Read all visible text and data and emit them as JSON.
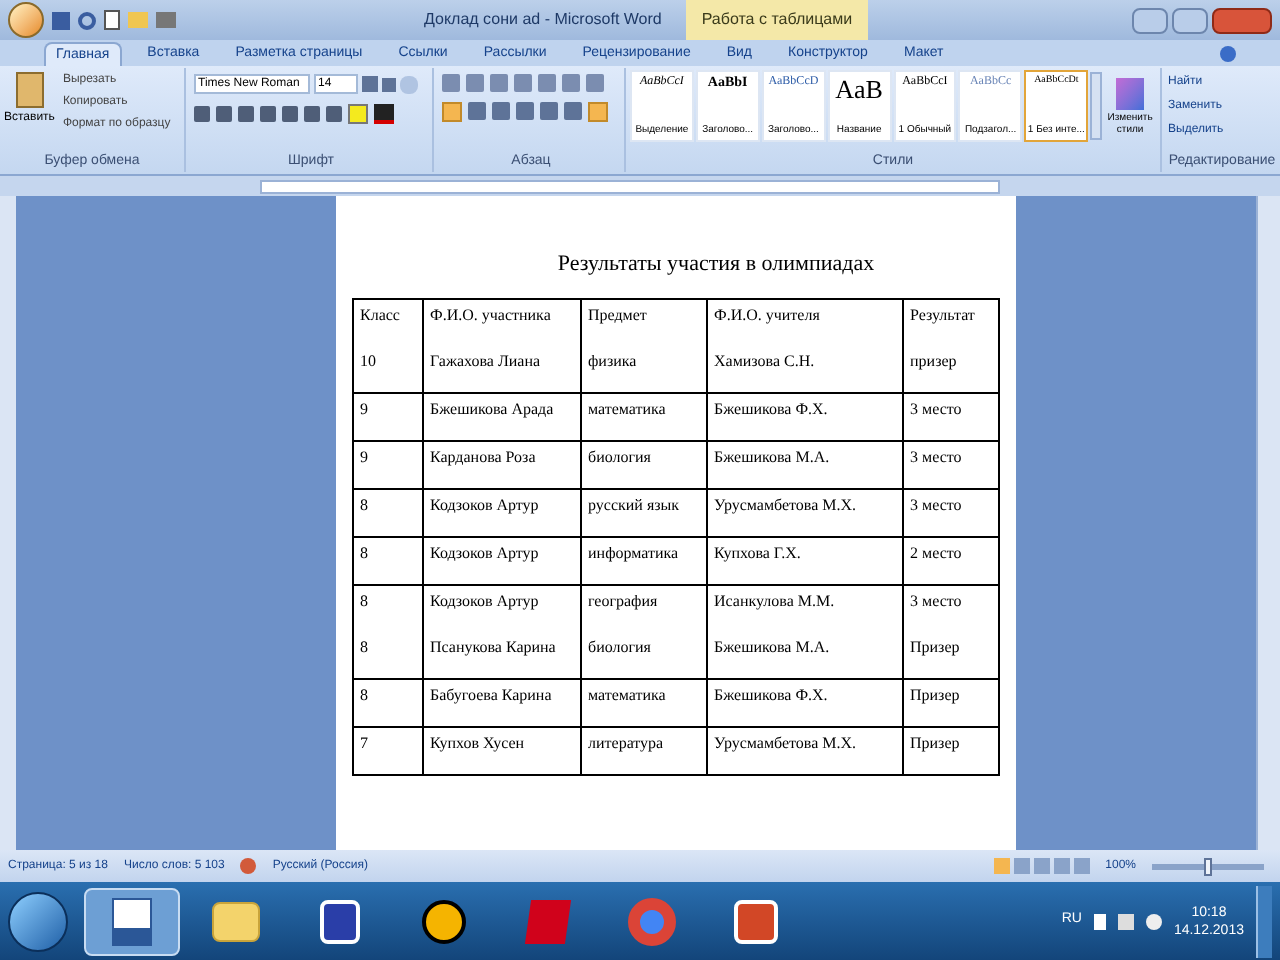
{
  "window": {
    "title": "Доклад сони ad - Microsoft Word",
    "context_tab": "Работа с таблицами"
  },
  "tabs": [
    {
      "label": "Главная",
      "selected": true
    },
    {
      "label": "Вставка",
      "selected": false
    },
    {
      "label": "Разметка страницы",
      "selected": false
    },
    {
      "label": "Ссылки",
      "selected": false
    },
    {
      "label": "Рассылки",
      "selected": false
    },
    {
      "label": "Рецензирование",
      "selected": false
    },
    {
      "label": "Вид",
      "selected": false
    },
    {
      "label": "Конструктор",
      "selected": false
    },
    {
      "label": "Макет",
      "selected": false
    }
  ],
  "ribbon": {
    "clipboard": {
      "label": "Буфер обмена",
      "paste": "Вставить",
      "items": [
        "Вырезать",
        "Копировать",
        "Формат по образцу"
      ]
    },
    "font": {
      "label": "Шрифт",
      "font_name": "Times New Roman",
      "font_size": "14"
    },
    "paragraph": {
      "label": "Абзац"
    },
    "styles": {
      "label": "Стили",
      "change": "Изменить стили",
      "items": [
        {
          "preview": "AaBbCcI",
          "name": "Выделение",
          "selected": false
        },
        {
          "preview": "AaBbI",
          "name": "Заголово...",
          "selected": false
        },
        {
          "preview": "AaBbCcD",
          "name": "Заголово...",
          "selected": false
        },
        {
          "preview": "AaB",
          "name": "Название",
          "selected": false
        },
        {
          "preview": "AaBbCcI",
          "name": "1 Обычный",
          "selected": false
        },
        {
          "preview": "AaBbCc",
          "name": "Подзагол...",
          "selected": false
        },
        {
          "preview": "AaBbCcDt",
          "name": "1 Без инте...",
          "selected": true
        }
      ]
    },
    "editing": {
      "label": "Редактирование",
      "items": [
        "Найти",
        "Заменить",
        "Выделить"
      ]
    }
  },
  "document": {
    "title": "Результаты участия в олимпиадах",
    "rows": [
      {
        "cells": [
          [
            "Класс",
            "10"
          ],
          [
            "Ф.И.О. участника",
            "Гажахова Лиана"
          ],
          [
            "Предмет",
            "физика"
          ],
          [
            "Ф.И.О. учителя",
            "Хамизова С.Н."
          ],
          [
            "Результат",
            "призер"
          ]
        ]
      },
      {
        "cells": [
          [
            "9"
          ],
          [
            "Бжешикова Арада"
          ],
          [
            "математика"
          ],
          [
            "Бжешикова Ф.Х."
          ],
          [
            "3  место"
          ]
        ]
      },
      {
        "cells": [
          [
            "9"
          ],
          [
            "Карданова Роза"
          ],
          [
            "биология"
          ],
          [
            "Бжешикова М.А."
          ],
          [
            "3  место"
          ]
        ]
      },
      {
        "cells": [
          [
            "8"
          ],
          [
            "Кодзоков Артур"
          ],
          [
            "русский язык"
          ],
          [
            "Урусмамбетова М.Х."
          ],
          [
            "3  место"
          ]
        ]
      },
      {
        "cells": [
          [
            "8"
          ],
          [
            "Кодзоков Артур"
          ],
          [
            "информатика"
          ],
          [
            "Купхова Г.Х."
          ],
          [
            "2 место"
          ]
        ]
      },
      {
        "cells": [
          [
            "8",
            "8"
          ],
          [
            "Кодзоков Артур",
            "Псанукова Карина"
          ],
          [
            "география",
            "биология"
          ],
          [
            "Исанкулова М.М.",
            "Бжешикова М.А."
          ],
          [
            "3 место",
            "Призер"
          ]
        ]
      },
      {
        "cells": [
          [
            "8"
          ],
          [
            "Бабугоева Карина"
          ],
          [
            "математика"
          ],
          [
            "Бжешикова Ф.Х."
          ],
          [
            "Призер"
          ]
        ]
      },
      {
        "cells": [
          [
            "7"
          ],
          [
            "Купхов Хусен"
          ],
          [
            "литература"
          ],
          [
            "Урусмамбетова М.Х."
          ],
          [
            "Призер"
          ]
        ]
      }
    ]
  },
  "status_bar": {
    "page": "Страница: 5 из 18",
    "words": "Число слов: 5 103",
    "language": "Русский (Россия)",
    "zoom": "100%",
    "zoom_slider": {
      "level": 0.5
    }
  },
  "taskbar": {
    "apps": [
      {
        "kind": "word",
        "selected": true
      },
      {
        "kind": "folder",
        "selected": false
      },
      {
        "kind": "disk",
        "selected": false
      },
      {
        "kind": "player",
        "selected": false
      },
      {
        "kind": "antivirus",
        "selected": false
      },
      {
        "kind": "browser",
        "selected": false
      },
      {
        "kind": "slides",
        "selected": false
      }
    ],
    "language": "RU",
    "time": "10:18",
    "date": "14.12.2013"
  }
}
